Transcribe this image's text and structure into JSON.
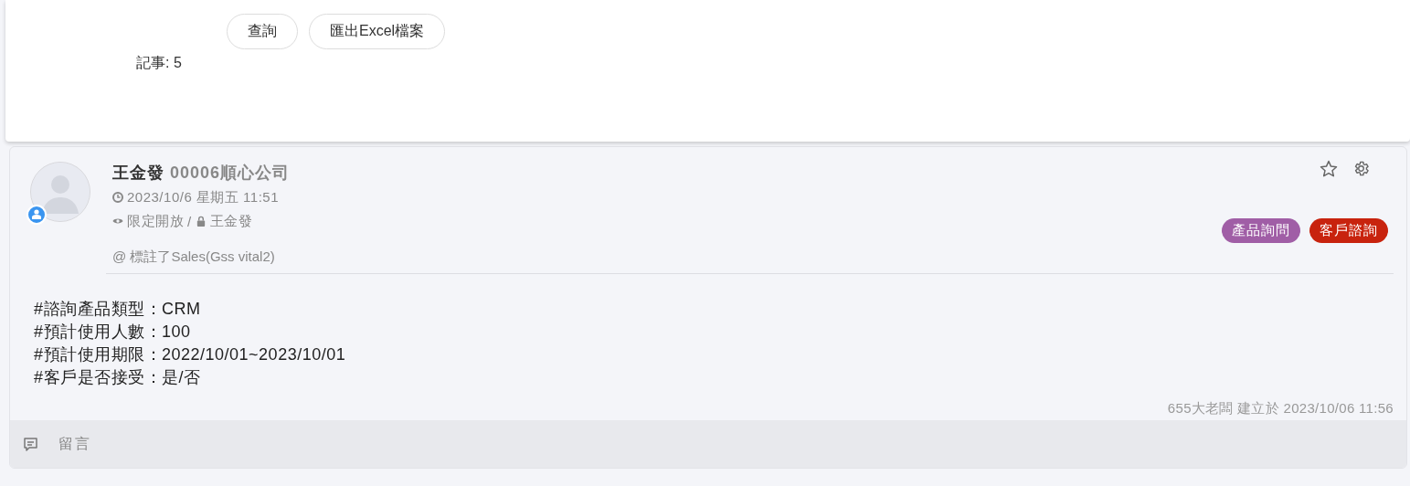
{
  "toolbar": {
    "buttons": [
      "查詢",
      "匯出Excel檔案"
    ],
    "record_count": "記事: 5"
  },
  "post": {
    "author": "王金發",
    "company": "00006順心公司",
    "datetime": "2023/10/6  星期五  11:51",
    "visibility": "限定開放",
    "separator": "/",
    "owner": "王金發",
    "mention": "@ 標註了Sales(Gss vital2)",
    "tags": [
      {
        "label": "產品詢問",
        "color": "#a05ea6"
      },
      {
        "label": "客戶諮詢",
        "color": "#c8230e"
      }
    ],
    "body": [
      "#諮詢產品類型：CRM",
      "#預計使用人數：100",
      "#預計使用期限：2022/10/01~2023/10/01",
      "#客戶是否接受：是/否"
    ],
    "created": "655大老闆 建立於 2023/10/06 11:56",
    "comment_label": "留言"
  }
}
